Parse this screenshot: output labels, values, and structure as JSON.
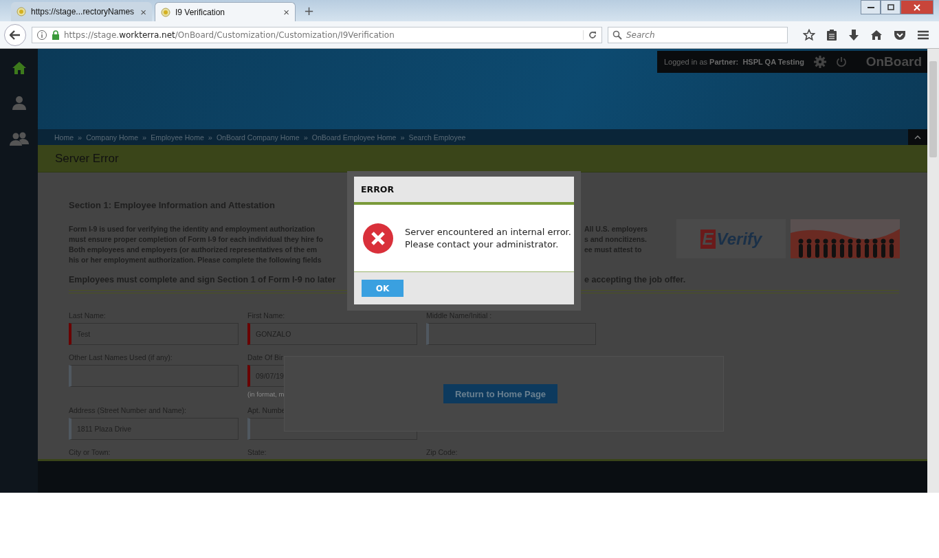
{
  "browser": {
    "tabs": [
      {
        "label": "https://stage...rectoryNames",
        "selected": false,
        "close": "×"
      },
      {
        "label": "I9 Verification",
        "selected": true,
        "close": "×"
      }
    ],
    "new_tab": "+",
    "url": {
      "scheme_host": "https://stage.",
      "domain": "workterra.net",
      "path": "/OnBoard/Customization/Customization/I9Verification"
    },
    "search": {
      "placeholder": "Search"
    }
  },
  "header": {
    "logged_in_label": "Logged in as",
    "partner_label": "Partner:",
    "partner_name": "HSPL QA Testing",
    "app_name": "OnBoard"
  },
  "breadcrumb": {
    "separator": "»",
    "items": [
      "Home",
      "Company Home",
      "Employee Home",
      "OnBoard Company Home",
      "OnBoard Employee Home",
      "Search Employee"
    ]
  },
  "page_title": "Server Error",
  "section_title": "Section 1: Employee Information and Attestation",
  "intro_left": [
    "Form I-9 is used for verifying the identity and employment authorization",
    "must ensure proper completion of Form I-9 for each individual they hire fo",
    "Both employees and employers (or authorized representatives of the em",
    "his or her employment authorization. Please complete the following fields"
  ],
  "intro_right": [
    "All U.S. employers",
    "s and noncitizens.",
    "ee must attest to"
  ],
  "logo": {
    "mark": "E",
    "text": "Verify"
  },
  "instruction_left": "Employees must complete and sign Section 1 of Form I-9 no later",
  "instruction_right": "e accepting the job offer.",
  "form_rows": [
    {
      "fields": [
        {
          "kind": "input",
          "label": "Last Name:",
          "value": "Test",
          "required": true
        },
        {
          "kind": "input",
          "label": "First Name:",
          "value": "GONZALO",
          "required": true
        },
        {
          "kind": "input",
          "label": "Middle Name/Initial :",
          "required": false
        }
      ]
    },
    {
      "fields": [
        {
          "kind": "input",
          "label": "Other Last Names Used (if any):",
          "required": false
        },
        {
          "kind": "input",
          "label": "Date Of Bir",
          "value": "09/07/19",
          "required": true,
          "hint": "(in format, m"
        }
      ]
    },
    {
      "fields": [
        {
          "kind": "input",
          "label": "Address (Street Number and Name):",
          "value": "1811 Plaza Drive",
          "required": false
        },
        {
          "kind": "input",
          "label": "Apt. Numbe",
          "required": false
        }
      ]
    },
    {
      "fields": [
        {
          "kind": "label",
          "label": "City or Town:"
        },
        {
          "kind": "label",
          "label": "State:"
        },
        {
          "kind": "label",
          "label": "Zip Code:"
        }
      ]
    }
  ],
  "return_button": "Return to Home Page",
  "dialog": {
    "title": "ERROR",
    "message": [
      "Server encountered an internal error.",
      "Please contact your administrator."
    ],
    "ok": "OK"
  }
}
